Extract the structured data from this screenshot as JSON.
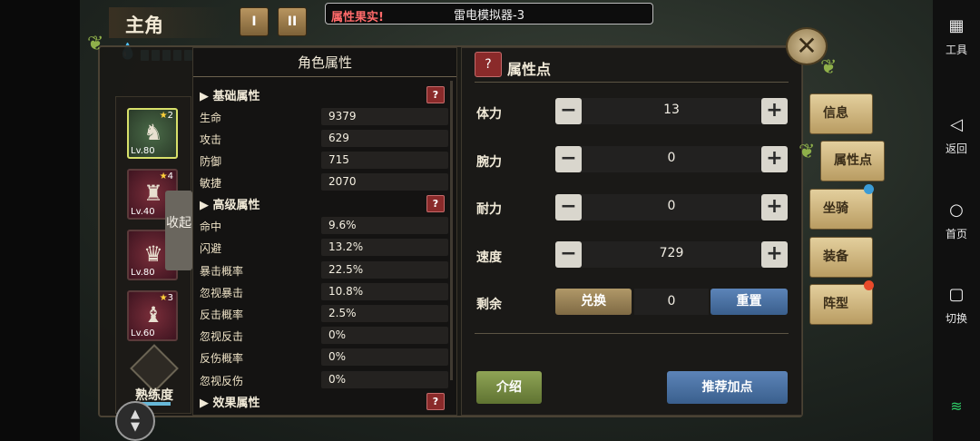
{
  "emulator": {
    "window_title": "雷电模拟器-3",
    "notice": "属性果实!",
    "side": [
      {
        "label": "工具",
        "icon": "grid-icon"
      },
      {
        "label": "返回",
        "icon": "back-icon"
      },
      {
        "label": "首页",
        "icon": "home-icon"
      },
      {
        "label": "切换",
        "icon": "switch-icon"
      }
    ]
  },
  "header": {
    "title": "主角",
    "tab1": "I",
    "tab2": "II"
  },
  "roster": {
    "heroes": [
      {
        "level": "Lv.80",
        "stars": "2",
        "selected": true
      },
      {
        "level": "Lv.40",
        "stars": "4",
        "selected": false
      },
      {
        "level": "Lv.80",
        "stars": "",
        "selected": false
      },
      {
        "level": "Lv.60",
        "stars": "3",
        "selected": false
      }
    ],
    "collapse": "收起",
    "mastery": "熟练度"
  },
  "attributes": {
    "title": "角色属性",
    "basic_title": "基础属性",
    "advanced_title": "高级属性",
    "effect_title": "效果属性",
    "help": "?",
    "basic": [
      {
        "name": "生命",
        "value": "9379"
      },
      {
        "name": "攻击",
        "value": "629"
      },
      {
        "name": "防御",
        "value": "715"
      },
      {
        "name": "敏捷",
        "value": "2070"
      }
    ],
    "advanced": [
      {
        "name": "命中",
        "value": "9.6%"
      },
      {
        "name": "闪避",
        "value": "13.2%"
      },
      {
        "name": "暴击概率",
        "value": "22.5%"
      },
      {
        "name": "忽视暴击",
        "value": "10.8%"
      },
      {
        "name": "反击概率",
        "value": "2.5%"
      },
      {
        "name": "忽视反击",
        "value": "0%"
      },
      {
        "name": "反伤概率",
        "value": "0%"
      },
      {
        "name": "忽视反伤",
        "value": "0%"
      }
    ]
  },
  "points": {
    "title": "属性点",
    "help": "?",
    "stats": [
      {
        "name": "体力",
        "value": "13"
      },
      {
        "name": "腕力",
        "value": "0"
      },
      {
        "name": "耐力",
        "value": "0"
      },
      {
        "name": "速度",
        "value": "729"
      }
    ],
    "remaining_label": "剩余",
    "remaining_value": "0",
    "exchange": "兑换",
    "reset": "重置",
    "intro": "介绍",
    "recommend": "推荐加点",
    "minus": "−",
    "plus": "+"
  },
  "side_tabs": [
    {
      "label": "信息",
      "active": false
    },
    {
      "label": "属性点",
      "active": true
    },
    {
      "label": "坐骑",
      "active": false
    },
    {
      "label": "装备",
      "active": false
    },
    {
      "label": "阵型",
      "active": false
    }
  ],
  "colors": {
    "accent_red": "#8a2a2a",
    "accent_blue": "#3a5f8d",
    "accent_green": "#5f7332",
    "gold": "#b99c62"
  }
}
